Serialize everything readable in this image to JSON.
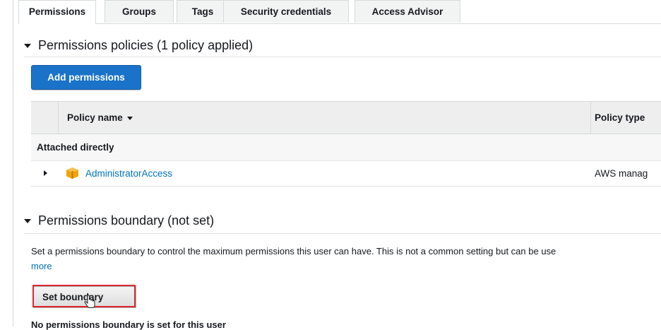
{
  "tabs": [
    {
      "label": "Permissions",
      "active": true
    },
    {
      "label": "Groups",
      "active": false
    },
    {
      "label": "Tags",
      "active": false
    },
    {
      "label": "Security credentials",
      "active": false
    },
    {
      "label": "Access Advisor",
      "active": false
    }
  ],
  "permissions_policies": {
    "heading": "Permissions policies (1 policy applied)",
    "add_button": "Add permissions",
    "table": {
      "columns": [
        "Policy name",
        "Policy type"
      ],
      "group_label": "Attached directly",
      "rows": [
        {
          "name": "AdministratorAccess",
          "type": "AWS manag",
          "icon": "aws-managed-policy-icon"
        }
      ]
    }
  },
  "permissions_boundary": {
    "heading": "Permissions boundary (not set)",
    "description": "Set a permissions boundary to control the maximum permissions this user can have. This is not a common setting but can be use",
    "learn_more": "more",
    "set_button": "Set boundary",
    "status_text": "No permissions boundary is set for this user"
  },
  "colors": {
    "primary_button": "#1a73c8",
    "link": "#0073bb",
    "highlight": "#e0262b",
    "policy_icon": "#f0a30a"
  }
}
